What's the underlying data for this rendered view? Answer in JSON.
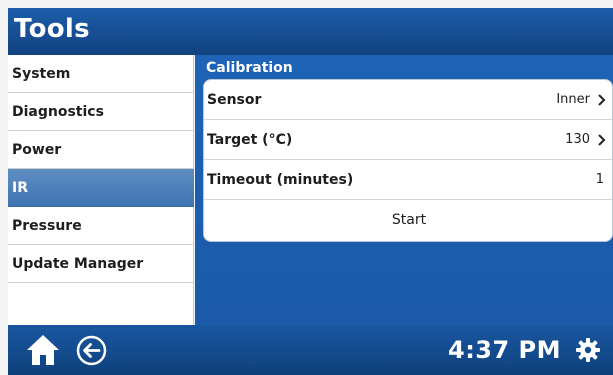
{
  "header": {
    "title": "Tools"
  },
  "sidebar": {
    "items": [
      {
        "label": "System"
      },
      {
        "label": "Diagnostics"
      },
      {
        "label": "Power"
      },
      {
        "label": "IR"
      },
      {
        "label": "Pressure"
      },
      {
        "label": "Update Manager"
      }
    ],
    "selected": "IR"
  },
  "calibration": {
    "section_title": "Calibration",
    "rows": [
      {
        "label": "Sensor",
        "value": "Inner"
      },
      {
        "label": "Target (°C)",
        "value": "130"
      },
      {
        "label": "Timeout (minutes)",
        "value": "1"
      }
    ],
    "start_label": "Start"
  },
  "footer": {
    "clock": "4:37 PM",
    "icons": [
      "home-icon",
      "back-icon",
      "gear-icon"
    ]
  },
  "colors": {
    "header_blue": "#174e95",
    "panel_blue": "#1e63b6",
    "selected_item": "#4a7fbb",
    "text_dark": "#1e1e1e"
  }
}
